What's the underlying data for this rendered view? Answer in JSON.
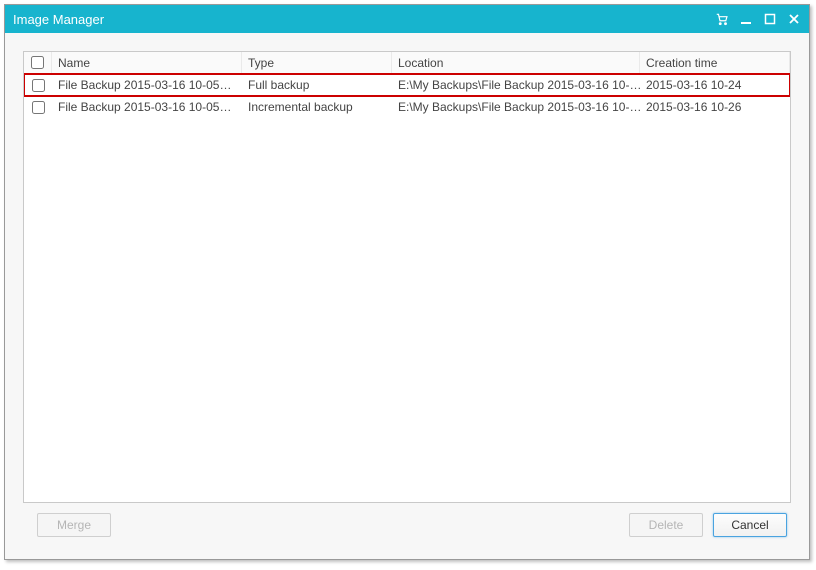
{
  "window": {
    "title": "Image Manager"
  },
  "table": {
    "headers": {
      "name": "Name",
      "type": "Type",
      "location": "Location",
      "creation_time": "Creation time"
    },
    "rows": [
      {
        "name": "File Backup 2015-03-16 10-05…",
        "type": "Full backup",
        "location": "E:\\My Backups\\File Backup 2015-03-16 10-…",
        "creation_time": "2015-03-16 10-24",
        "highlight": true
      },
      {
        "name": "File Backup 2015-03-16 10-05…",
        "type": "Incremental backup",
        "location": "E:\\My Backups\\File Backup 2015-03-16 10-…",
        "creation_time": "2015-03-16 10-26",
        "highlight": false
      }
    ]
  },
  "buttons": {
    "merge": "Merge",
    "delete": "Delete",
    "cancel": "Cancel"
  }
}
